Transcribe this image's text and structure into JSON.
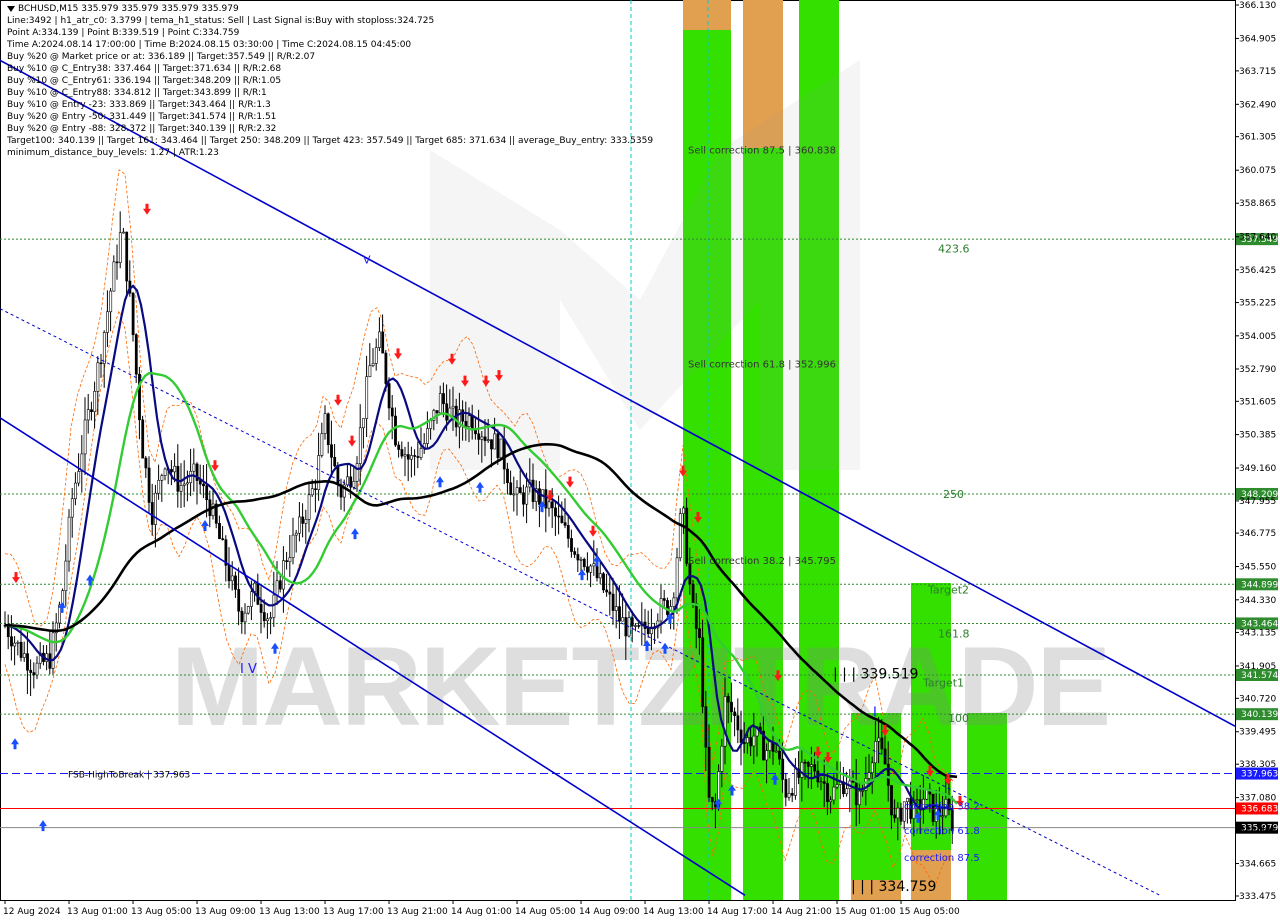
{
  "header": {
    "symbol_line": "BCHUSD,M15  335.979 335.979 335.979 335.979",
    "lines": [
      "Line:3492 | h1_atr_c0: 3.3799 | tema_h1_status: Sell | Last Signal is:Buy with stoploss:324.725",
      "Point A:334.139 | Point B:339.519 | Point C:334.759",
      "Time A:2024.08.14 17:00:00 | Time B:2024.08.15 03:30:00 | Time C:2024.08.15 04:45:00",
      "Buy %20 @ Market price or at: 336.189 || Target:357.549 || R/R:2.07",
      "Buy %10 @ C_Entry38: 337.464 || Target:371.634 || R/R:2.68",
      "Buy %10 @ C_Entry61: 336.194 || Target:348.209 || R/R:1.05",
      "Buy %10 @ C_Entry88: 334.812 || Target:343.899 || R/R:1",
      "Buy %10 @ Entry -23: 333.869 || Target:343.464 || R/R:1.3",
      "Buy %20 @ Entry -50: 331.449 || Target:341.574 || R/R:1.51",
      "Buy %20 @ Entry -88: 328.372 || Target:340.139 || R/R:2.32",
      "Target100: 340.139 || Target 161: 343.464 || Target 250: 348.209 || Target 423: 357.549 || Target 685: 371.634 || average_Buy_entry: 333.5359",
      "minimum_distance_buy_levels: 1.27 | ATR:1.23"
    ]
  },
  "watermark": "MARKETZITRADE",
  "colors": {
    "background": "#ffffff",
    "green_level": "#2e8b2e",
    "blue_level": "#1a1aff",
    "red_level": "#ff0000",
    "current_price": "#000000",
    "bar_green": "#33e000",
    "bar_orange": "#e0a050",
    "trend_line": "#0000cc",
    "ma_black": "#000000",
    "ma_navy": "#0a0a80",
    "ma_green": "#33cc33",
    "envelope": "#ff6600",
    "cyan_vline": "#00cccc"
  },
  "chart_data": {
    "type": "candlestick",
    "symbol": "BCHUSD",
    "timeframe": "M15",
    "ylim": [
      333.475,
      366.13
    ],
    "price_ticks": [
      "366.130",
      "364.905",
      "363.715",
      "362.490",
      "361.305",
      "360.075",
      "358.865",
      "357.640",
      "356.425",
      "355.225",
      "354.005",
      "352.790",
      "351.605",
      "350.385",
      "349.160",
      "347.955",
      "346.775",
      "345.550",
      "344.330",
      "343.135",
      "341.905",
      "340.720",
      "339.495",
      "338.305",
      "337.080",
      "335.895",
      "334.665",
      "333.475"
    ],
    "time_labels": [
      "12 Aug 2024",
      "13 Aug 01:00",
      "13 Aug 05:00",
      "13 Aug 09:00",
      "13 Aug 13:00",
      "13 Aug 17:00",
      "13 Aug 21:00",
      "14 Aug 01:00",
      "14 Aug 05:00",
      "14 Aug 09:00",
      "14 Aug 13:00",
      "14 Aug 17:00",
      "14 Aug 21:00",
      "15 Aug 01:00",
      "15 Aug 05:00"
    ],
    "levels": [
      {
        "value": 357.549,
        "label": "357.549",
        "style": "green-dotted"
      },
      {
        "value": 348.209,
        "label": "348.209",
        "style": "green-dotted"
      },
      {
        "value": 344.899,
        "label": "344.899",
        "style": "green-dotted"
      },
      {
        "value": 343.464,
        "label": "343.464",
        "style": "green-dotted"
      },
      {
        "value": 341.574,
        "label": "341.574",
        "style": "green-dotted"
      },
      {
        "value": 340.139,
        "label": "340.139",
        "style": "green-dotted"
      },
      {
        "value": 337.963,
        "label": "337.963",
        "style": "blue-dashed"
      },
      {
        "value": 336.683,
        "label": "336.683",
        "style": "red-solid"
      },
      {
        "value": 335.979,
        "label": "335.979",
        "style": "current"
      }
    ],
    "annotations": [
      {
        "text": "Sell correction 87.5 | 360.838",
        "price": 360.838
      },
      {
        "text": "Sell correction 61.8 | 352.996",
        "price": 352.996
      },
      {
        "text": "Sell correction 38.2 | 345.795",
        "price": 345.795
      },
      {
        "text": "423.6",
        "price": 357.2
      },
      {
        "text": "250",
        "price": 348.2
      },
      {
        "text": "Target2",
        "price": 344.7
      },
      {
        "text": "161.8",
        "price": 343.1
      },
      {
        "text": "Target1",
        "price": 341.3
      },
      {
        "text": "100",
        "price": 340.0
      },
      {
        "text": "| | | 339.519",
        "price": 341.6
      },
      {
        "text": "| | | 334.759",
        "price": 333.8
      },
      {
        "text": "FSB-HighToBreak | 337.963",
        "price": 337.963
      },
      {
        "text": "correction 38.2",
        "price": 336.8
      },
      {
        "text": "correction 61.8",
        "price": 335.9
      },
      {
        "text": "correction 87.5",
        "price": 334.9
      },
      {
        "text": "V",
        "price": 356.8
      },
      {
        "text": "I V",
        "price": 341.8
      },
      {
        "text": "I",
        "price": 340.2
      }
    ]
  }
}
